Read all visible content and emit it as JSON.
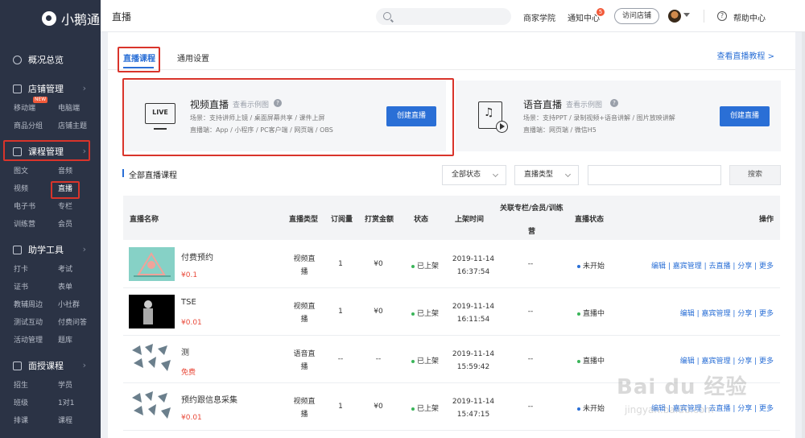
{
  "brand": {
    "name": "小鹅通"
  },
  "sidebar": {
    "groups": [
      {
        "label": "概况总览",
        "items": []
      },
      {
        "label": "店铺管理",
        "items": [
          "移动端",
          "电脑端",
          "商品分组",
          "店铺主题"
        ],
        "badge": "NEW"
      },
      {
        "label": "课程管理",
        "items": [
          "图文",
          "音频",
          "视频",
          "直播",
          "电子书",
          "专栏",
          "训练营",
          "会员"
        ]
      },
      {
        "label": "助学工具",
        "items": [
          "打卡",
          "考试",
          "证书",
          "表单",
          "教辅周边",
          "小社群",
          "测试互动",
          "付费问答",
          "活动管理",
          "题库"
        ]
      },
      {
        "label": "面授课程",
        "items": [
          "招生",
          "学员",
          "班级",
          "1对1",
          "排课",
          "课程"
        ]
      }
    ]
  },
  "topbar": {
    "title": "直播",
    "links": {
      "academy": "商家学院",
      "notify": "通知中心",
      "notify_count": "5",
      "visit": "访问店铺",
      "help": "帮助中心"
    }
  },
  "tabs": [
    "直播课程",
    "通用设置"
  ],
  "tutorial_link": "查看直播教程 >",
  "live_types": [
    {
      "title": "视频直播",
      "example": "查看示例图",
      "scene": "场景：支持讲师上镜 / 桌面屏幕共享 / 课件上屏",
      "clients": "直播端：App / 小程序 / PC客户端 / 网页端 / OBS",
      "button": "创建直播",
      "icon_text": "LIVE"
    },
    {
      "title": "语音直播",
      "example": "查看示例图",
      "scene": "场景：支持PPT / 录制视频+语音讲解 / 图片放映讲解",
      "clients": "直播端：网页端 / 微信H5",
      "button": "创建直播"
    }
  ],
  "list": {
    "title": "全部直播课程",
    "filters": {
      "status": "全部状态",
      "type": "直播类型",
      "search": "搜索"
    },
    "headers": {
      "name": "直播名称",
      "type": "直播类型",
      "subs": "订阅量",
      "reward": "打赏金额",
      "status": "状态",
      "time": "上架时间",
      "rel1": "关联专栏/会员/训练",
      "rel2": "营",
      "live": "直播状态",
      "ops": "操作"
    },
    "rows": [
      {
        "name": "付费预约",
        "price": "¥0.1",
        "type1": "视频直",
        "type2": "播",
        "subs": "1",
        "reward": "¥0",
        "status": "已上架",
        "date": "2019-11-14",
        "time": "16:37:54",
        "rel": "--",
        "live": "未开始",
        "live_color": "#2a6fd6",
        "ops": "编辑 | 嘉宾管理 | 去直播 | 分享 | 更多"
      },
      {
        "name": "TSE",
        "price": "¥0.01",
        "type1": "视频直",
        "type2": "播",
        "subs": "1",
        "reward": "¥0",
        "status": "已上架",
        "date": "2019-11-14",
        "time": "16:11:54",
        "rel": "--",
        "live": "直播中",
        "live_color": "#3bb55a",
        "ops": "编辑 | 嘉宾管理 | 分享 | 更多"
      },
      {
        "name": "测",
        "price": "免费",
        "type1": "语音直",
        "type2": "播",
        "subs": "--",
        "reward": "--",
        "status": "已上架",
        "date": "2019-11-14",
        "time": "15:59:42",
        "rel": "--",
        "live": "直播中",
        "live_color": "#3bb55a",
        "ops": "编辑 | 嘉宾管理 | 分享 | 更多"
      },
      {
        "name": "预约跟信息采集",
        "price": "¥0.01",
        "type1": "视频直",
        "type2": "播",
        "subs": "1",
        "reward": "¥0",
        "status": "已上架",
        "date": "2019-11-14",
        "time": "15:47:15",
        "rel": "--",
        "live": "未开始",
        "live_color": "#2a6fd6",
        "ops": "编辑 | 嘉宾管理 | 去直播 | 分享 | 更多"
      }
    ]
  },
  "watermark": {
    "main": "Bai du 经验",
    "sub": "jingyan.baidu.com"
  },
  "colors": {
    "sidebar_bg": "#2b3345",
    "accent": "#2a6fd6",
    "price": "#e94a3a",
    "highlight": "#d9342b",
    "green": "#3bb55a"
  }
}
